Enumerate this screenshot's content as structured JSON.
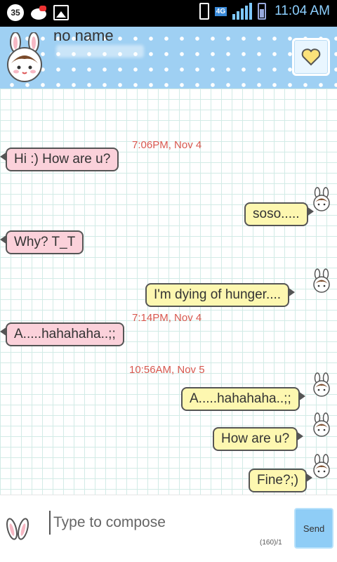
{
  "status_bar": {
    "notification_count": "35",
    "network": "4G",
    "time": "11:04 AM"
  },
  "header": {
    "contact_name": "no name"
  },
  "messages": [
    {
      "kind": "timestamp",
      "text": "7:06PM, Nov 4"
    },
    {
      "kind": "in",
      "text": "Hi :) How are u?"
    },
    {
      "kind": "out",
      "text": "soso....."
    },
    {
      "kind": "in",
      "text": "Why? T_T"
    },
    {
      "kind": "out",
      "text": "I'm dying of hunger...."
    },
    {
      "kind": "timestamp",
      "text": "7:14PM, Nov 4"
    },
    {
      "kind": "in",
      "text": "A.....hahahaha..;;"
    },
    {
      "kind": "timestamp",
      "text": "10:56AM, Nov 5"
    },
    {
      "kind": "out",
      "text": "A.....hahahaha..;;"
    },
    {
      "kind": "out",
      "text": "How are u?"
    },
    {
      "kind": "out",
      "text": "Fine?;)"
    }
  ],
  "compose": {
    "placeholder": "Type to compose",
    "send_label": "Send",
    "char_count": "(160)/1"
  },
  "colors": {
    "header_bg": "#9fd0f3",
    "incoming_bubble": "#fbd1da",
    "outgoing_bubble": "#fdf7b0",
    "timestamp": "#d8584f",
    "send_button": "#8fcdf6"
  },
  "icons": [
    "notification-35-icon",
    "hello-kitty-icon",
    "gallery-icon",
    "vibrate-icon",
    "signal-icon",
    "battery-icon",
    "heart-icon",
    "bunny-avatar-icon",
    "bunny-ears-icon"
  ]
}
